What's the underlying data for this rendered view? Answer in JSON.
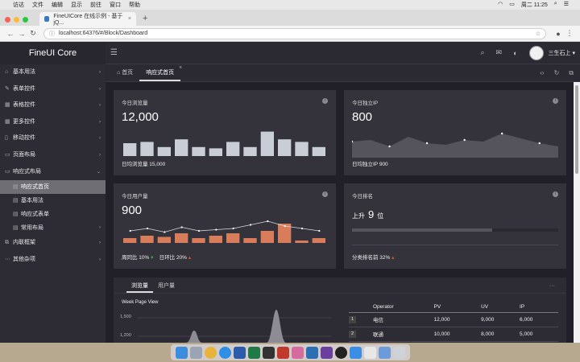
{
  "mac": {
    "apple": "",
    "menus": [
      "访达",
      "文件",
      "编辑",
      "显示",
      "前往",
      "窗口",
      "帮助"
    ],
    "clock": "周二 11:25"
  },
  "browser": {
    "tab_title": "FineUICore 在线示例 - 基于 jQ...",
    "tab_close": "×",
    "new_tab": "+",
    "url": "localhost:64376/#/Block/Dashboard"
  },
  "app": {
    "brand": "FineUI Core",
    "user": "三生石上"
  },
  "sidebar": {
    "items": [
      {
        "icon": "home-icon",
        "glyph": "⌂",
        "label": "基本用法",
        "arrow": "›"
      },
      {
        "icon": "edit-icon",
        "glyph": "✎",
        "label": "表单控件",
        "arrow": "›"
      },
      {
        "icon": "table-icon",
        "glyph": "▦",
        "label": "表格控件",
        "arrow": "›"
      },
      {
        "icon": "grid-icon",
        "glyph": "▦",
        "label": "更多控件",
        "arrow": "›"
      },
      {
        "icon": "mobile-icon",
        "glyph": "▯",
        "label": "移动控件",
        "arrow": "›"
      },
      {
        "icon": "layout-icon",
        "glyph": "▭",
        "label": "页面布局",
        "arrow": "›"
      },
      {
        "icon": "responsive-icon",
        "glyph": "▭",
        "label": "响应式布局",
        "arrow": "⌄"
      }
    ],
    "subitems": [
      {
        "label": "响应式首页",
        "arrow": "",
        "active": true
      },
      {
        "label": "基本用法",
        "arrow": "",
        "active": false
      },
      {
        "label": "响应式表单",
        "arrow": "",
        "active": false
      },
      {
        "label": "常用布局",
        "arrow": "›",
        "active": false
      }
    ],
    "tail": [
      {
        "icon": "frame-icon",
        "glyph": "⧉",
        "label": "内联框架",
        "arrow": "›"
      },
      {
        "icon": "more-icon",
        "glyph": "⋯",
        "label": "其他杂项",
        "arrow": "›"
      }
    ]
  },
  "tabs": {
    "home": "首页",
    "current": "响应式首页",
    "close": "×"
  },
  "cards": {
    "pv": {
      "title": "今日浏览量",
      "value": "12,000",
      "footer": "日均浏览量 15,000",
      "bars": [
        5,
        5.5,
        3.5,
        6.5,
        3.5,
        3,
        5.5,
        3.5,
        9.5,
        6.5,
        5.5,
        3.5
      ]
    },
    "ip": {
      "title": "今日独立IP",
      "value": "800",
      "footer": "日均独立IP 900",
      "points": [
        20,
        22,
        14,
        26,
        18,
        16,
        22,
        20,
        30,
        24,
        18,
        14
      ]
    },
    "users": {
      "title": "今日用户量",
      "value": "900",
      "foot1": "周同比 10%",
      "foot1_arrow": "▾",
      "foot2": "日环比 20%",
      "foot2_arrow": "▴",
      "bars": [
        2,
        3,
        2.5,
        4,
        2,
        3,
        4,
        2,
        5,
        8,
        1,
        2
      ],
      "line": [
        10,
        12,
        9,
        13,
        10,
        11,
        12,
        15,
        18,
        14,
        12,
        10
      ]
    },
    "rank": {
      "title": "今日排名",
      "prefix": "上升",
      "value": "9",
      "suffix": "位",
      "footer": "分类排名前 32%",
      "footer_arrow": "▴",
      "progress": 0.68
    }
  },
  "bottom": {
    "tab1": "浏览量",
    "tab2": "用户量",
    "more": "···",
    "chart_title": "Week Page View",
    "yticks": [
      "1,500",
      "1,200"
    ],
    "table": {
      "headers": [
        "Operator",
        "PV",
        "UV",
        "IP"
      ],
      "rows": [
        {
          "n": "1",
          "op": "电信",
          "pv": "12,000",
          "uv": "9,000",
          "ip": "6,000"
        },
        {
          "n": "2",
          "op": "联通",
          "pv": "10,000",
          "uv": "8,000",
          "ip": "5,000"
        }
      ]
    }
  }
}
